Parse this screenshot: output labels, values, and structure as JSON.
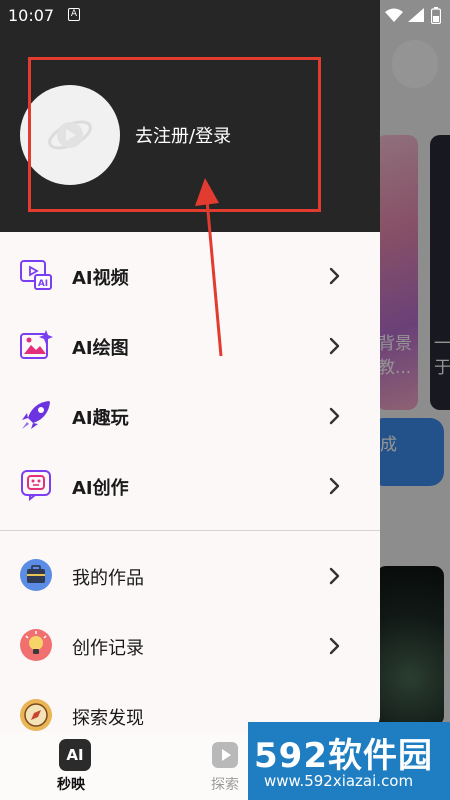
{
  "status_bar": {
    "time": "10:07",
    "notification_badge": "A"
  },
  "drawer": {
    "login_text": "去注册/登录",
    "menu_primary": [
      {
        "label": "AI视频",
        "icon": "ai-video-icon"
      },
      {
        "label": "AI绘图",
        "icon": "ai-drawing-icon"
      },
      {
        "label": "AI趣玩",
        "icon": "rocket-icon"
      },
      {
        "label": "AI创作",
        "icon": "robot-face-icon"
      }
    ],
    "menu_secondary": [
      {
        "label": "我的作品",
        "icon": "briefcase-icon"
      },
      {
        "label": "创作记录",
        "icon": "lightbulb-icon"
      },
      {
        "label": "探索发现",
        "icon": "compass-icon"
      }
    ]
  },
  "background": {
    "card1_text": "背景\n教...",
    "card2_text": "一\n于",
    "blue_card_text": "成"
  },
  "bottom_nav": {
    "tab1_icon_text": "AI",
    "tab1_label": "秒映",
    "tab2_label": "探索"
  },
  "watermark": {
    "title": "592软件园",
    "url": "www.592xiazai.com"
  },
  "colors": {
    "accent_red": "#e23b2f",
    "drawer_header": "#262626",
    "icon_purple": "#7b3ff2",
    "icon_pink": "#e3307a"
  }
}
